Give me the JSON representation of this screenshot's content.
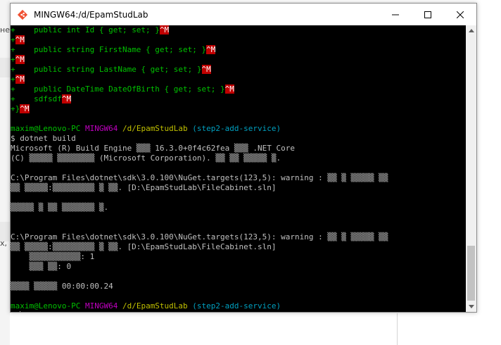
{
  "background": {
    "left_text_1": "не",
    "left_text_2": "x,"
  },
  "window": {
    "title": "MINGW64:/d/EpamStudLab",
    "icon": "git-bash-icon",
    "controls": {
      "minimize": "minimize-icon",
      "maximize": "maximize-icon",
      "close": "close-icon"
    }
  },
  "terminal": {
    "diff": [
      {
        "prefix": "+",
        "code": "    public int Id { get; set; }",
        "cr": "^M"
      },
      {
        "prefix": "+",
        "code": "",
        "cr": "^M"
      },
      {
        "prefix": "+",
        "code": "    public string FirstName { get; set; }",
        "cr": "^M"
      },
      {
        "prefix": "+",
        "code": "",
        "cr": "^M"
      },
      {
        "prefix": "+",
        "code": "    public string LastName { get; set; }",
        "cr": "^M"
      },
      {
        "prefix": "+",
        "code": "",
        "cr": "^M"
      },
      {
        "prefix": "+",
        "code": "    public DateTime DateOfBirth { get; set; }",
        "cr": "^M"
      },
      {
        "prefix": "+",
        "code": "    sdfsdf",
        "cr": "^M"
      },
      {
        "prefix": "+",
        "code": "}",
        "cr": "^M"
      }
    ],
    "prompt1": {
      "user": "maxim@Lenovo-PC",
      "env": "MINGW64",
      "path": "/d/EpamStudLab",
      "branch": "(step2-add-service)"
    },
    "command": "$ dotnet build",
    "output": [
      "Microsoft (R) Build Engine ▒▒▒ 16.3.0+0f4c62fea ▒▒▒ .NET Core",
      "(C) ▒▒▒▒▒ ▒▒▒▒▒▒▒▒ (Microsoft Corporation). ▒▒ ▒▒ ▒▒▒▒▒ ▒.",
      "",
      "C:\\Program Files\\dotnet\\sdk\\3.0.100\\NuGet.targets(123,5): warning : ▒▒ ▒ ▒▒▒▒▒ ▒▒",
      "▒▒ ▒▒▒▒▒:▒▒▒▒▒▒▒▒▒ ▒ ▒▒. [D:\\EpamStudLab\\FileCabinet.sln]",
      "",
      "▒▒▒▒▒ ▒ ▒▒ ▒▒▒▒▒▒▒ ▒.",
      "",
      "",
      "C:\\Program Files\\dotnet\\sdk\\3.0.100\\NuGet.targets(123,5): warning : ▒▒ ▒ ▒▒▒▒▒ ▒▒",
      "▒▒ ▒▒▒▒▒:▒▒▒▒▒▒▒▒▒ ▒ ▒▒. [D:\\EpamStudLab\\FileCabinet.sln]",
      "    ▒▒▒▒▒▒▒▒▒▒▒: 1",
      "    ▒▒▒ ▒▒: 0",
      "",
      "▒▒▒▒ ▒▒▒▒▒ 00:00:00.24",
      ""
    ],
    "prompt2": {
      "user": "maxim@Lenovo-PC",
      "env": "MINGW64",
      "path": "/d/EpamStudLab",
      "branch": "(step2-add-service)"
    },
    "input_prompt": "$ "
  },
  "colors": {
    "diff_green": "#00c000",
    "cr_red": "#c00000",
    "env_magenta": "#c000c0",
    "path_yellow": "#c0c000",
    "branch_cyan": "#00a0c0"
  }
}
